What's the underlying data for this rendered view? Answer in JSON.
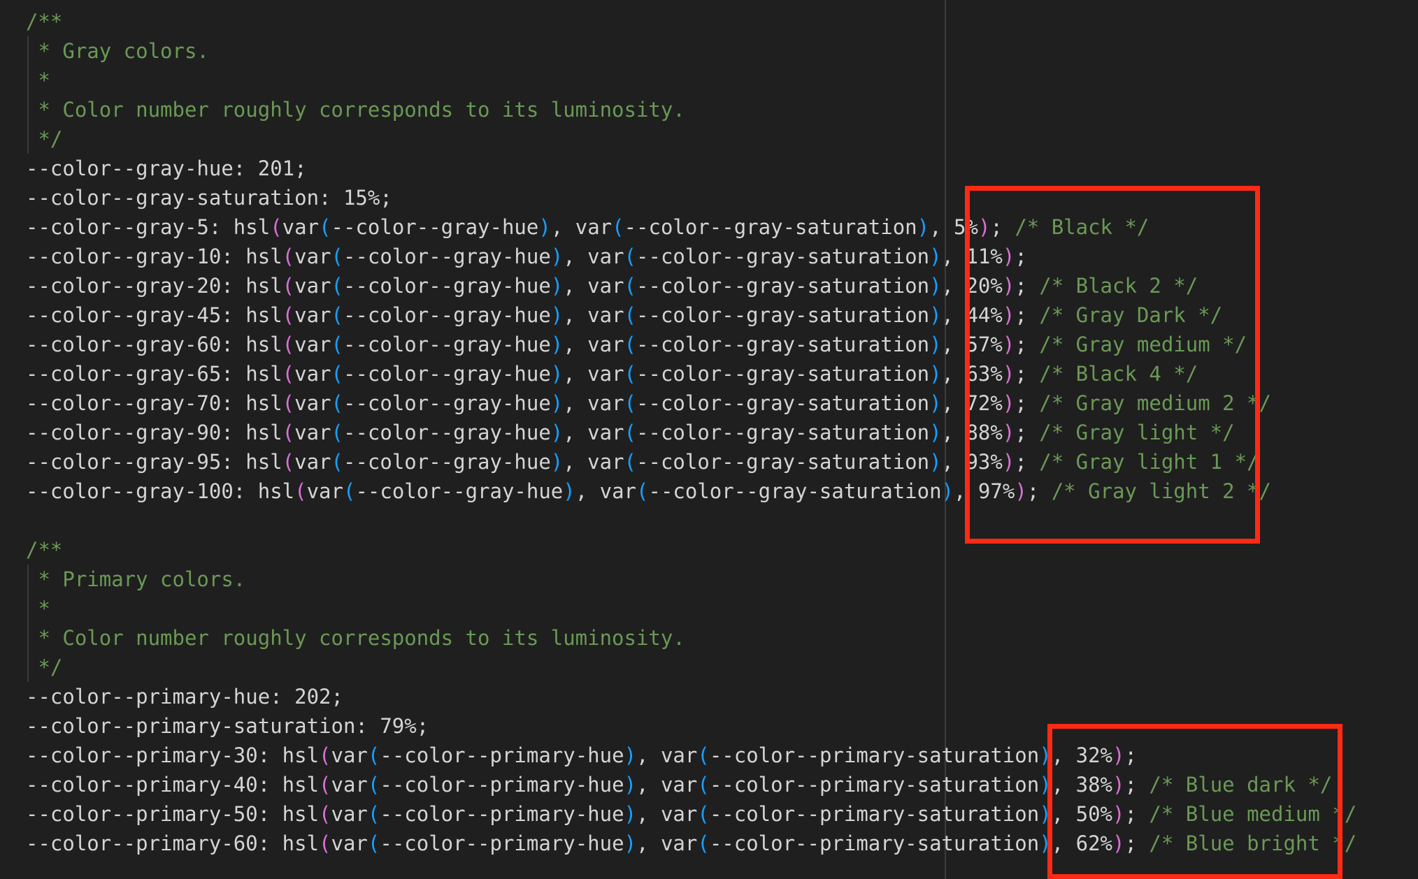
{
  "editor": {
    "lines": [
      [
        {
          "t": "/**",
          "c": "com"
        }
      ],
      [
        {
          "t": " * Gray colors.",
          "c": "com"
        }
      ],
      [
        {
          "t": " *",
          "c": "com"
        }
      ],
      [
        {
          "t": " * Color number roughly corresponds to its luminosity.",
          "c": "com"
        }
      ],
      [
        {
          "t": " */",
          "c": "com"
        }
      ],
      [
        {
          "t": "--color--gray-hue: 201;",
          "c": "txt"
        }
      ],
      [
        {
          "t": "--color--gray-saturation: 15%;",
          "c": "txt"
        }
      ],
      [
        {
          "t": "--color--gray-5: hsl",
          "c": "txt"
        },
        {
          "t": "(",
          "c": "p1"
        },
        {
          "t": "var",
          "c": "txt"
        },
        {
          "t": "(",
          "c": "p2"
        },
        {
          "t": "--color--gray-hue",
          "c": "txt"
        },
        {
          "t": ")",
          "c": "p2"
        },
        {
          "t": ", var",
          "c": "txt"
        },
        {
          "t": "(",
          "c": "p2"
        },
        {
          "t": "--color--gray-saturation",
          "c": "txt"
        },
        {
          "t": ")",
          "c": "p2"
        },
        {
          "t": ", 5%",
          "c": "txt"
        },
        {
          "t": ")",
          "c": "p1"
        },
        {
          "t": "; ",
          "c": "txt"
        },
        {
          "t": "/* Black */",
          "c": "com"
        }
      ],
      [
        {
          "t": "--color--gray-10: hsl",
          "c": "txt"
        },
        {
          "t": "(",
          "c": "p1"
        },
        {
          "t": "var",
          "c": "txt"
        },
        {
          "t": "(",
          "c": "p2"
        },
        {
          "t": "--color--gray-hue",
          "c": "txt"
        },
        {
          "t": ")",
          "c": "p2"
        },
        {
          "t": ", var",
          "c": "txt"
        },
        {
          "t": "(",
          "c": "p2"
        },
        {
          "t": "--color--gray-saturation",
          "c": "txt"
        },
        {
          "t": ")",
          "c": "p2"
        },
        {
          "t": ", 11%",
          "c": "txt"
        },
        {
          "t": ")",
          "c": "p1"
        },
        {
          "t": ";",
          "c": "txt"
        }
      ],
      [
        {
          "t": "--color--gray-20: hsl",
          "c": "txt"
        },
        {
          "t": "(",
          "c": "p1"
        },
        {
          "t": "var",
          "c": "txt"
        },
        {
          "t": "(",
          "c": "p2"
        },
        {
          "t": "--color--gray-hue",
          "c": "txt"
        },
        {
          "t": ")",
          "c": "p2"
        },
        {
          "t": ", var",
          "c": "txt"
        },
        {
          "t": "(",
          "c": "p2"
        },
        {
          "t": "--color--gray-saturation",
          "c": "txt"
        },
        {
          "t": ")",
          "c": "p2"
        },
        {
          "t": ", 20%",
          "c": "txt"
        },
        {
          "t": ")",
          "c": "p1"
        },
        {
          "t": "; ",
          "c": "txt"
        },
        {
          "t": "/* Black 2 */",
          "c": "com"
        }
      ],
      [
        {
          "t": "--color--gray-45: hsl",
          "c": "txt"
        },
        {
          "t": "(",
          "c": "p1"
        },
        {
          "t": "var",
          "c": "txt"
        },
        {
          "t": "(",
          "c": "p2"
        },
        {
          "t": "--color--gray-hue",
          "c": "txt"
        },
        {
          "t": ")",
          "c": "p2"
        },
        {
          "t": ", var",
          "c": "txt"
        },
        {
          "t": "(",
          "c": "p2"
        },
        {
          "t": "--color--gray-saturation",
          "c": "txt"
        },
        {
          "t": ")",
          "c": "p2"
        },
        {
          "t": ", 44%",
          "c": "txt"
        },
        {
          "t": ")",
          "c": "p1"
        },
        {
          "t": "; ",
          "c": "txt"
        },
        {
          "t": "/* Gray Dark */",
          "c": "com"
        }
      ],
      [
        {
          "t": "--color--gray-60: hsl",
          "c": "txt"
        },
        {
          "t": "(",
          "c": "p1"
        },
        {
          "t": "var",
          "c": "txt"
        },
        {
          "t": "(",
          "c": "p2"
        },
        {
          "t": "--color--gray-hue",
          "c": "txt"
        },
        {
          "t": ")",
          "c": "p2"
        },
        {
          "t": ", var",
          "c": "txt"
        },
        {
          "t": "(",
          "c": "p2"
        },
        {
          "t": "--color--gray-saturation",
          "c": "txt"
        },
        {
          "t": ")",
          "c": "p2"
        },
        {
          "t": ", 57%",
          "c": "txt"
        },
        {
          "t": ")",
          "c": "p1"
        },
        {
          "t": "; ",
          "c": "txt"
        },
        {
          "t": "/* Gray medium */",
          "c": "com"
        }
      ],
      [
        {
          "t": "--color--gray-65: hsl",
          "c": "txt"
        },
        {
          "t": "(",
          "c": "p1"
        },
        {
          "t": "var",
          "c": "txt"
        },
        {
          "t": "(",
          "c": "p2"
        },
        {
          "t": "--color--gray-hue",
          "c": "txt"
        },
        {
          "t": ")",
          "c": "p2"
        },
        {
          "t": ", var",
          "c": "txt"
        },
        {
          "t": "(",
          "c": "p2"
        },
        {
          "t": "--color--gray-saturation",
          "c": "txt"
        },
        {
          "t": ")",
          "c": "p2"
        },
        {
          "t": ", 63%",
          "c": "txt"
        },
        {
          "t": ")",
          "c": "p1"
        },
        {
          "t": "; ",
          "c": "txt"
        },
        {
          "t": "/* Black 4 */",
          "c": "com"
        }
      ],
      [
        {
          "t": "--color--gray-70: hsl",
          "c": "txt"
        },
        {
          "t": "(",
          "c": "p1"
        },
        {
          "t": "var",
          "c": "txt"
        },
        {
          "t": "(",
          "c": "p2"
        },
        {
          "t": "--color--gray-hue",
          "c": "txt"
        },
        {
          "t": ")",
          "c": "p2"
        },
        {
          "t": ", var",
          "c": "txt"
        },
        {
          "t": "(",
          "c": "p2"
        },
        {
          "t": "--color--gray-saturation",
          "c": "txt"
        },
        {
          "t": ")",
          "c": "p2"
        },
        {
          "t": ", 72%",
          "c": "txt"
        },
        {
          "t": ")",
          "c": "p1"
        },
        {
          "t": "; ",
          "c": "txt"
        },
        {
          "t": "/* Gray medium 2 */",
          "c": "com"
        }
      ],
      [
        {
          "t": "--color--gray-90: hsl",
          "c": "txt"
        },
        {
          "t": "(",
          "c": "p1"
        },
        {
          "t": "var",
          "c": "txt"
        },
        {
          "t": "(",
          "c": "p2"
        },
        {
          "t": "--color--gray-hue",
          "c": "txt"
        },
        {
          "t": ")",
          "c": "p2"
        },
        {
          "t": ", var",
          "c": "txt"
        },
        {
          "t": "(",
          "c": "p2"
        },
        {
          "t": "--color--gray-saturation",
          "c": "txt"
        },
        {
          "t": ")",
          "c": "p2"
        },
        {
          "t": ", 88%",
          "c": "txt"
        },
        {
          "t": ")",
          "c": "p1"
        },
        {
          "t": "; ",
          "c": "txt"
        },
        {
          "t": "/* Gray light */",
          "c": "com"
        }
      ],
      [
        {
          "t": "--color--gray-95: hsl",
          "c": "txt"
        },
        {
          "t": "(",
          "c": "p1"
        },
        {
          "t": "var",
          "c": "txt"
        },
        {
          "t": "(",
          "c": "p2"
        },
        {
          "t": "--color--gray-hue",
          "c": "txt"
        },
        {
          "t": ")",
          "c": "p2"
        },
        {
          "t": ", var",
          "c": "txt"
        },
        {
          "t": "(",
          "c": "p2"
        },
        {
          "t": "--color--gray-saturation",
          "c": "txt"
        },
        {
          "t": ")",
          "c": "p2"
        },
        {
          "t": ", 93%",
          "c": "txt"
        },
        {
          "t": ")",
          "c": "p1"
        },
        {
          "t": "; ",
          "c": "txt"
        },
        {
          "t": "/* Gray light 1 */",
          "c": "com"
        }
      ],
      [
        {
          "t": "--color--gray-100: hsl",
          "c": "txt"
        },
        {
          "t": "(",
          "c": "p1"
        },
        {
          "t": "var",
          "c": "txt"
        },
        {
          "t": "(",
          "c": "p2"
        },
        {
          "t": "--color--gray-hue",
          "c": "txt"
        },
        {
          "t": ")",
          "c": "p2"
        },
        {
          "t": ", var",
          "c": "txt"
        },
        {
          "t": "(",
          "c": "p2"
        },
        {
          "t": "--color--gray-saturation",
          "c": "txt"
        },
        {
          "t": ")",
          "c": "p2"
        },
        {
          "t": ", 97%",
          "c": "txt"
        },
        {
          "t": ")",
          "c": "p1"
        },
        {
          "t": "; ",
          "c": "txt"
        },
        {
          "t": "/* Gray light 2 */",
          "c": "com"
        }
      ],
      [],
      [
        {
          "t": "/**",
          "c": "com"
        }
      ],
      [
        {
          "t": " * Primary colors.",
          "c": "com"
        }
      ],
      [
        {
          "t": " *",
          "c": "com"
        }
      ],
      [
        {
          "t": " * Color number roughly corresponds to its luminosity.",
          "c": "com"
        }
      ],
      [
        {
          "t": " */",
          "c": "com"
        }
      ],
      [
        {
          "t": "--color--primary-hue: 202;",
          "c": "txt"
        }
      ],
      [
        {
          "t": "--color--primary-saturation: 79%;",
          "c": "txt"
        }
      ],
      [
        {
          "t": "--color--primary-30: hsl",
          "c": "txt"
        },
        {
          "t": "(",
          "c": "p1"
        },
        {
          "t": "var",
          "c": "txt"
        },
        {
          "t": "(",
          "c": "p2"
        },
        {
          "t": "--color--primary-hue",
          "c": "txt"
        },
        {
          "t": ")",
          "c": "p2"
        },
        {
          "t": ", var",
          "c": "txt"
        },
        {
          "t": "(",
          "c": "p2"
        },
        {
          "t": "--color--primary-saturation",
          "c": "txt"
        },
        {
          "t": ")",
          "c": "p2"
        },
        {
          "t": ", 32%",
          "c": "txt"
        },
        {
          "t": ")",
          "c": "p1"
        },
        {
          "t": ";",
          "c": "txt"
        }
      ],
      [
        {
          "t": "--color--primary-40: hsl",
          "c": "txt"
        },
        {
          "t": "(",
          "c": "p1"
        },
        {
          "t": "var",
          "c": "txt"
        },
        {
          "t": "(",
          "c": "p2"
        },
        {
          "t": "--color--primary-hue",
          "c": "txt"
        },
        {
          "t": ")",
          "c": "p2"
        },
        {
          "t": ", var",
          "c": "txt"
        },
        {
          "t": "(",
          "c": "p2"
        },
        {
          "t": "--color--primary-saturation",
          "c": "txt"
        },
        {
          "t": ")",
          "c": "p2"
        },
        {
          "t": ", 38%",
          "c": "txt"
        },
        {
          "t": ")",
          "c": "p1"
        },
        {
          "t": "; ",
          "c": "txt"
        },
        {
          "t": "/* Blue dark */",
          "c": "com"
        }
      ],
      [
        {
          "t": "--color--primary-50: hsl",
          "c": "txt"
        },
        {
          "t": "(",
          "c": "p1"
        },
        {
          "t": "var",
          "c": "txt"
        },
        {
          "t": "(",
          "c": "p2"
        },
        {
          "t": "--color--primary-hue",
          "c": "txt"
        },
        {
          "t": ")",
          "c": "p2"
        },
        {
          "t": ", var",
          "c": "txt"
        },
        {
          "t": "(",
          "c": "p2"
        },
        {
          "t": "--color--primary-saturation",
          "c": "txt"
        },
        {
          "t": ")",
          "c": "p2"
        },
        {
          "t": ", 50%",
          "c": "txt"
        },
        {
          "t": ")",
          "c": "p1"
        },
        {
          "t": "; ",
          "c": "txt"
        },
        {
          "t": "/* Blue medium */",
          "c": "com"
        }
      ],
      [
        {
          "t": "--color--primary-60: hsl",
          "c": "txt"
        },
        {
          "t": "(",
          "c": "p1"
        },
        {
          "t": "var",
          "c": "txt"
        },
        {
          "t": "(",
          "c": "p2"
        },
        {
          "t": "--color--primary-hue",
          "c": "txt"
        },
        {
          "t": ")",
          "c": "p2"
        },
        {
          "t": ", var",
          "c": "txt"
        },
        {
          "t": "(",
          "c": "p2"
        },
        {
          "t": "--color--primary-saturation",
          "c": "txt"
        },
        {
          "t": ")",
          "c": "p2"
        },
        {
          "t": ", 62%",
          "c": "txt"
        },
        {
          "t": ")",
          "c": "p1"
        },
        {
          "t": "; ",
          "c": "txt"
        },
        {
          "t": "/* Blue bright */",
          "c": "com"
        }
      ]
    ]
  },
  "colors": {
    "background": "#1f1f1f",
    "text": "#d4d4d4",
    "comment": "#6a9955",
    "bracket_outer": "#da70d6",
    "bracket_inner": "#179fff",
    "highlight_box": "#ff2a14"
  }
}
